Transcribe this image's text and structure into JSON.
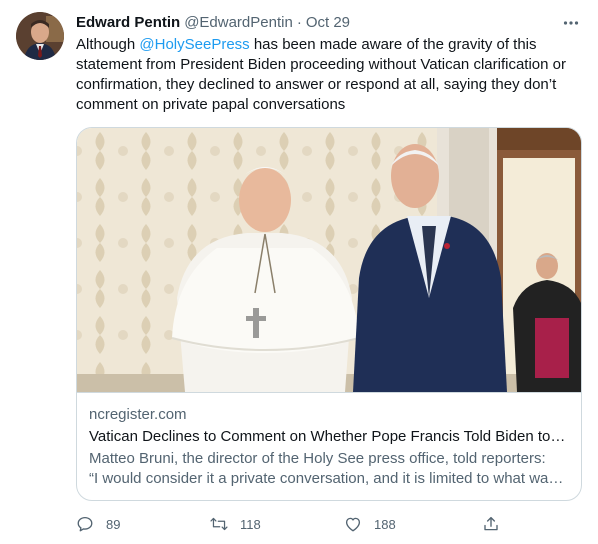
{
  "tweet": {
    "author_name": "Edward Pentin",
    "author_handle": "@EdwardPentin",
    "separator": "·",
    "timestamp": "Oct 29",
    "text_before_mention": "Although ",
    "mention": "@HolySeePress",
    "text_after_mention": " has been made aware of the gravity of this statement from President Biden proceeding without Vatican clarification or confirmation, they declined to answer or respond at all, saying they don’t comment on private papal conversations"
  },
  "card": {
    "domain": "ncregister.com",
    "title": "Vatican Declines to Comment on Whether Pope Francis Told Biden to Receive Communion",
    "description_line1": "Matteo Bruni, the director of the Holy See press office, told reporters:",
    "description_line2": "“I would consider it a private conversation, and it is limited to what was reported”"
  },
  "actions": {
    "replies": "89",
    "retweets": "118",
    "likes": "188"
  },
  "icons": {
    "more": "more-dots-icon",
    "reply": "reply-icon",
    "retweet": "retweet-icon",
    "like": "heart-icon",
    "share": "share-icon"
  },
  "colors": {
    "link": "#1d9bf0",
    "secondary_text": "#536471",
    "primary_text": "#0f1419",
    "border": "#cfd9de"
  }
}
